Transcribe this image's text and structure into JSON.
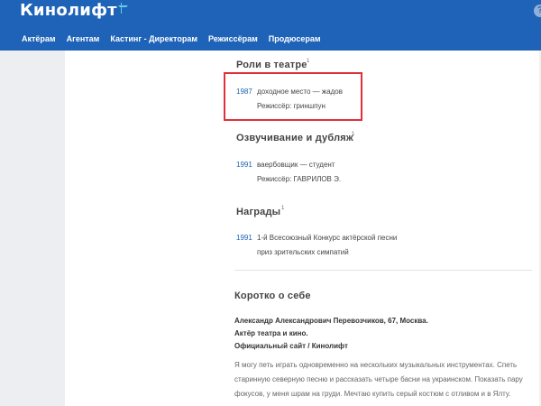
{
  "header": {
    "logo_text": "Кинолифт",
    "help_label": "?"
  },
  "nav": {
    "items": [
      "Актёрам",
      "Агентам",
      "Кастинг - Директорам",
      "Режиссёрам",
      "Продюсерам"
    ]
  },
  "sections": {
    "theatre": {
      "title": "Роли в театре",
      "count": "1",
      "entries": [
        {
          "year": "1987",
          "title": "доходное место — жадов",
          "director": "Режиссёр: гриншпун"
        }
      ]
    },
    "dubbing": {
      "title": "Озвучивание и дубляж",
      "count": "1",
      "entries": [
        {
          "year": "1991",
          "title": "ваербовщик — студент",
          "director": "Режиссёр: ГАВРИЛОВ Э."
        }
      ]
    },
    "awards": {
      "title": "Награды",
      "count": "1",
      "entries": [
        {
          "year": "1991",
          "line1": "1-й Всесоюзный Конкурс актёрской песни",
          "line2": "приз зрительских симпатий"
        }
      ]
    },
    "about": {
      "title": "Коротко о себе",
      "bold_lines": [
        "Александр Александрович Перевозчиков, 67, Москва.",
        "Актёр театра и кино.",
        "Официальный сайт / Кинолифт"
      ],
      "text": "Я могу петь играть одновременно на нескольких музыкальных инструментах. Спеть старинную северную песню и рассказать четыре басни на украинском. Показать пару фокусов, у меня шрам на груди. Мечтаю купить серый костюм с отливом и в Ялту."
    }
  },
  "colors": {
    "brand_blue": "#1e63b7",
    "highlight_red": "#e0303a"
  }
}
